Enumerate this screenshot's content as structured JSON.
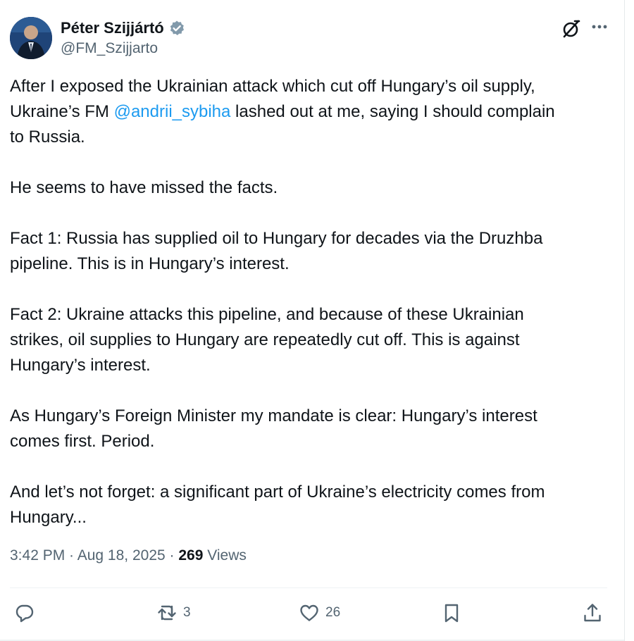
{
  "author": {
    "display_name": "Péter Szijjártó",
    "handle": "@FM_Szijjarto",
    "verified": true
  },
  "tweet": {
    "lines": [
      {
        "text": "After I exposed the Ukrainian attack which cut off Hungary’s oil supply,"
      },
      {
        "before": "Ukraine’s FM ",
        "mention": "@andrii_sybiha",
        "after": " lashed out at me, saying I should complain"
      },
      {
        "text": "to Russia."
      },
      {
        "text": "He seems to have missed the facts."
      },
      {
        "text": "Fact 1: Russia has supplied oil to Hungary for decades via the Druzhba"
      },
      {
        "text": "pipeline. This is in Hungary’s interest."
      },
      {
        "text": "Fact 2: Ukraine attacks this pipeline, and because of these Ukrainian"
      },
      {
        "text": "strikes, oil supplies to Hungary are repeatedly cut off. This is against"
      },
      {
        "text": "Hungary’s interest."
      },
      {
        "text": "As Hungary’s Foreign Minister my mandate is clear: Hungary’s interest"
      },
      {
        "text": "comes first. Period."
      },
      {
        "text": "And let’s not forget: a significant part of Ukraine’s electricity comes from"
      },
      {
        "text": "Hungary..."
      }
    ]
  },
  "meta": {
    "time": "3:42 PM",
    "separator": " · ",
    "date": "Aug 18, 2025",
    "views_count": "269",
    "views_label": " Views"
  },
  "actions": {
    "reply_count": "",
    "retweet_count": "3",
    "like_count": "26"
  },
  "icons": {
    "verified": "verified-badge-icon",
    "grok": "grok-icon",
    "more": "more-dots-icon",
    "reply": "reply-icon",
    "retweet": "retweet-icon",
    "like": "heart-icon",
    "bookmark": "bookmark-icon",
    "share": "share-icon"
  },
  "colors": {
    "mention": "#1d9bf0",
    "secondary_text": "#536471",
    "primary_text": "#0f1419",
    "verified_badge": "#829aab"
  }
}
